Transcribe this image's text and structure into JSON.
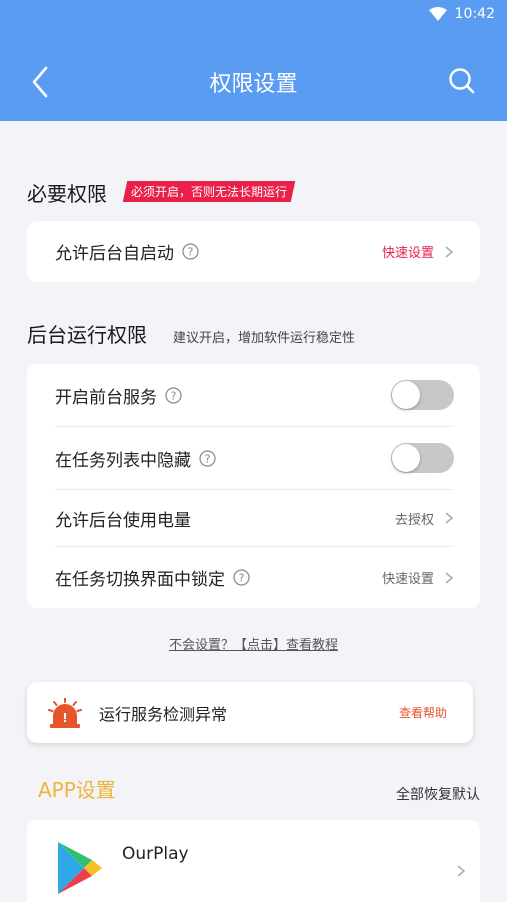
{
  "status_bar": {
    "time": "10:42"
  },
  "nav": {
    "title": "权限设置"
  },
  "required": {
    "title": "必要权限",
    "badge": "必须开启，否则无法长期运行",
    "row": {
      "label": "允许后台自启动",
      "action": "快速设置"
    }
  },
  "background": {
    "title": "后台运行权限",
    "subtitle": "建议开启，增加软件运行稳定性",
    "rows": [
      {
        "label": "开启前台服务",
        "toggle": false
      },
      {
        "label": "在任务列表中隐藏",
        "toggle": false
      },
      {
        "label": "允许后台使用电量",
        "action": "去授权"
      },
      {
        "label": "在任务切换界面中锁定",
        "action": "快速设置"
      }
    ]
  },
  "tutorial": {
    "text": "不会设置？【点击】查看教程"
  },
  "alert": {
    "text": "运行服务检测异常",
    "action": "查看帮助"
  },
  "app_settings": {
    "title": "APP设置",
    "restore": "全部恢复默认",
    "app_name": "OurPlay"
  },
  "colors": {
    "header": "#5a9cf2",
    "accent_red": "#e8204a",
    "accent_orange": "#f0b43a"
  }
}
